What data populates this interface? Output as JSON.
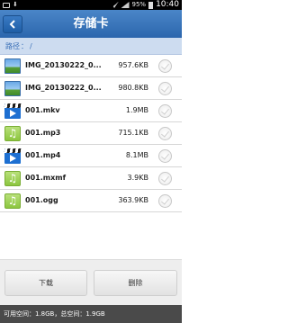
{
  "status_bar": {
    "battery_text": "95%",
    "time": "10:40"
  },
  "header": {
    "title": "存储卡"
  },
  "path_bar": {
    "label": "路径",
    "separator": "：",
    "path": "/"
  },
  "files": [
    {
      "name": "IMG_20130222_0...",
      "size": "957.6KB",
      "type": "image"
    },
    {
      "name": "IMG_20130222_0...",
      "size": "980.8KB",
      "type": "image"
    },
    {
      "name": "001.mkv",
      "size": "1.9MB",
      "type": "video"
    },
    {
      "name": "001.mp3",
      "size": "715.1KB",
      "type": "audio"
    },
    {
      "name": "001.mp4",
      "size": "8.1MB",
      "type": "video"
    },
    {
      "name": "001.mxmf",
      "size": "3.9KB",
      "type": "audio"
    },
    {
      "name": "001.ogg",
      "size": "363.9KB",
      "type": "audio"
    }
  ],
  "actions": {
    "download_label": "下载",
    "delete_label": "删除"
  },
  "storage": {
    "text": "可用空间：1.8GB，总空间：1.9GB"
  },
  "colors": {
    "title_bar": "#2c66ad",
    "path_text": "#3a6fb7",
    "path_bg": "#cddcf0",
    "storage_bg": "#4a4a4a"
  }
}
